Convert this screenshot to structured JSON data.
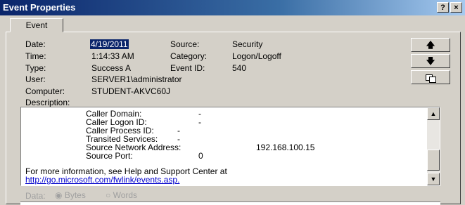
{
  "window": {
    "title": "Event Properties",
    "help_label": "?",
    "close_label": "×"
  },
  "tab": {
    "label": "Event"
  },
  "fields": {
    "date_label": "Date:",
    "date_value": "4/19/2011",
    "time_label": "Time:",
    "time_value": "1:14:33 AM",
    "type_label": "Type:",
    "type_value": "Success A",
    "user_label": "User:",
    "user_value": "SERVER1\\administrator",
    "computer_label": "Computer:",
    "computer_value": "STUDENT-AKVC60J",
    "source_label": "Source:",
    "source_value": "Security",
    "category_label": "Category:",
    "category_value": "Logon/Logoff",
    "eventid_label": "Event ID:",
    "eventid_value": "540"
  },
  "buttons": {
    "up_icon": "arrow-up-icon",
    "down_icon": "arrow-down-icon",
    "copy_icon": "copy-icon"
  },
  "description": {
    "label": "Description:",
    "lines": [
      {
        "key": "Caller Domain:",
        "value": "-"
      },
      {
        "key": "Caller Logon ID:",
        "value": "-"
      },
      {
        "key": "Caller Process ID:",
        "value": "-"
      },
      {
        "key": "Transited Services:",
        "value": "-"
      },
      {
        "key": "Source Network Address:",
        "value": "192.168.100.15"
      },
      {
        "key": "Source Port:",
        "value": "0"
      }
    ],
    "more_info": "For more information, see Help and Support Center at",
    "link": "http://go.microsoft.com/fwlink/events.asp."
  },
  "data_section": {
    "label": "Data:",
    "bytes_label": "Bytes",
    "words_label": "Words"
  }
}
